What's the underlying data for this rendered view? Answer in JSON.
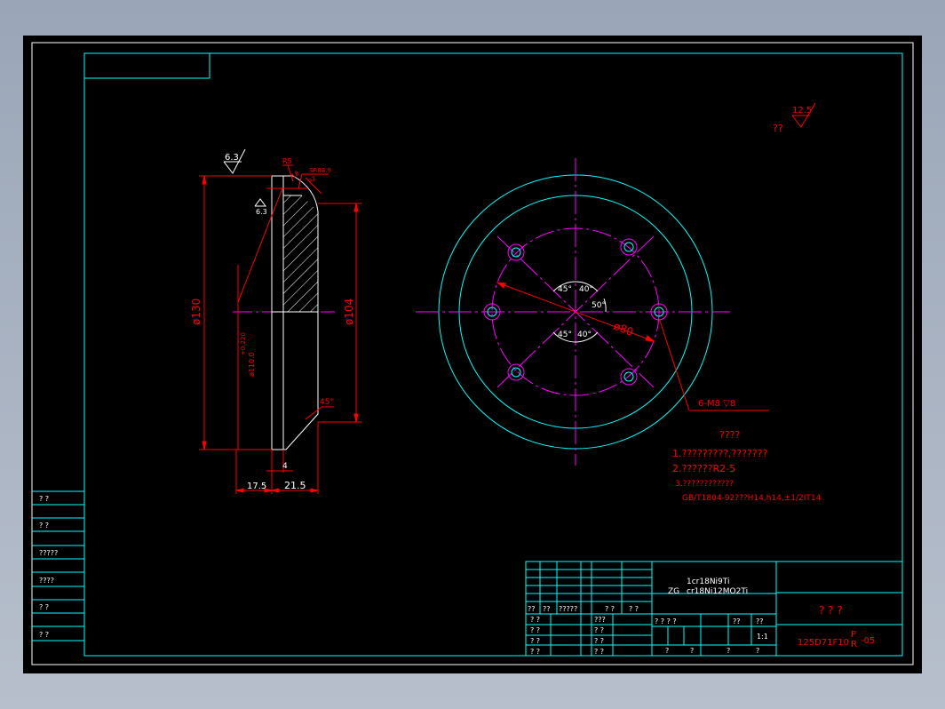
{
  "roughness": {
    "general_value": "12.5",
    "general_label": "??",
    "left_top": "6.3",
    "left_inner": "6.3"
  },
  "section_view": {
    "callouts": {
      "r5": "R5",
      "sr": "SR88.9",
      "small_a": "18",
      "small_b": "R2"
    },
    "dia_outer": "ø130",
    "dia_hole_value": "ø110.0",
    "dia_hole_tol": "+0.220",
    "dia_right": "ø104",
    "chamfer": "45°",
    "dim_4": "4",
    "dim_17_5": "17.5",
    "dim_21_5": "21.5"
  },
  "plan_view": {
    "angle_45_upper": "45°",
    "angle_40_upper": "40°",
    "angle_50": "50°",
    "angle_45_lower": "45°",
    "angle_40_lower": "40°",
    "pcd": "ø80",
    "holes_callout": "6-M8   ▽8"
  },
  "notes": {
    "title": "????",
    "line1": "1.?????????,???????",
    "line2": "2.??????R2-5",
    "line3": "3.????????????",
    "line4": "GB/T1804-92???H14,h14,±1/2IT14"
  },
  "left_strip": [
    "? ?",
    "? ?",
    "?????",
    "????",
    "? ?",
    "? ?"
  ],
  "title_block": {
    "material_line1": "1cr18Ni9Ti",
    "material_prefix": "ZG",
    "material_line2": "cr18Ni12MO2Ti",
    "part_name": "? ? ?",
    "drawing_no": "125D71F10",
    "drawing_suffix_top": "P",
    "drawing_suffix_r": "R",
    "drawing_suffix_num": "-05",
    "scale": "1:1",
    "header_row": [
      "??",
      "??",
      "?????",
      "? ?",
      "? ?"
    ],
    "left_rows": [
      "? ?",
      "? ?",
      "? ?",
      "? ?"
    ],
    "mid_top_label": "???",
    "mid_rows": [
      "? ?",
      "? ?",
      "? ?"
    ],
    "right_header": [
      "? ? ? ?",
      "??",
      "??"
    ],
    "bottom_row": [
      "?",
      "?",
      "?",
      "?"
    ]
  }
}
